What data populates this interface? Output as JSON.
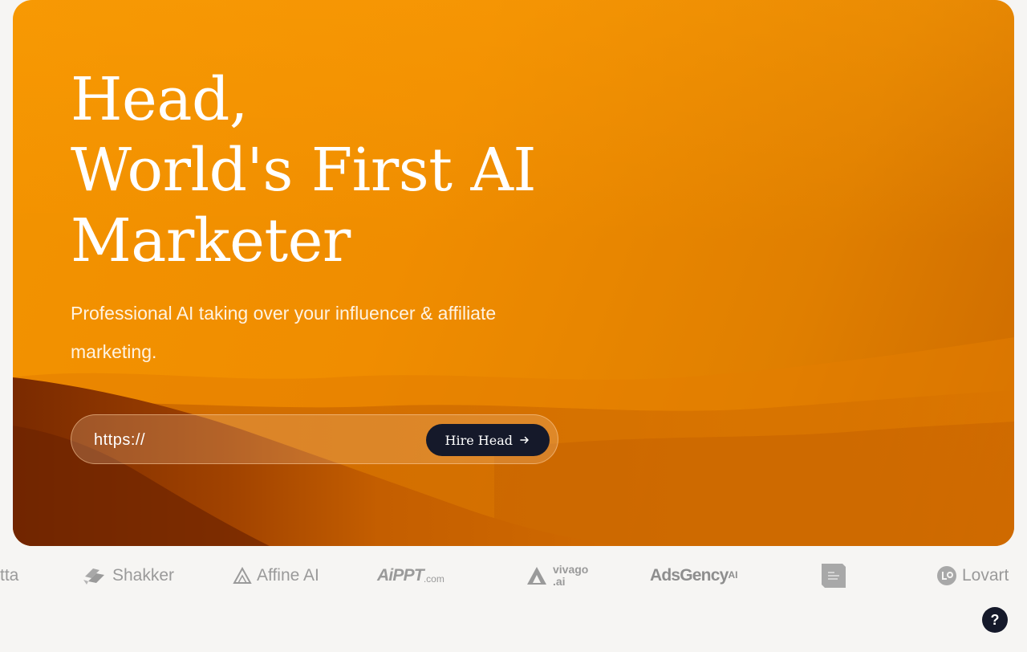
{
  "hero": {
    "title_line_1": "Head,",
    "title_line_2": "World's First AI",
    "title_line_3": "Marketer",
    "subtitle": "Professional AI taking over your influencer & affiliate marketing."
  },
  "form": {
    "url_placeholder": "https://",
    "submit_label": "Hire Head"
  },
  "logos": [
    {
      "name": "tta",
      "text": "tta"
    },
    {
      "name": "shakker",
      "text": "Shakker"
    },
    {
      "name": "affine-ai",
      "text": "Affine AI"
    },
    {
      "name": "aippt",
      "text": "AiPPT",
      "suffix": ".com"
    },
    {
      "name": "vivago",
      "text": "vivago",
      "suffix": ".ai"
    },
    {
      "name": "adsgency",
      "text": "AdsGency",
      "suffix": "AI"
    },
    {
      "name": "amazon-badge",
      "text": ""
    },
    {
      "name": "lovart",
      "text": "Lovart"
    }
  ],
  "help": {
    "label": "?"
  },
  "colors": {
    "accent": "#f39300",
    "button_dark": "#15192a",
    "logo_gray": "#9a9a9a",
    "page_bg": "#f6f5f3"
  }
}
